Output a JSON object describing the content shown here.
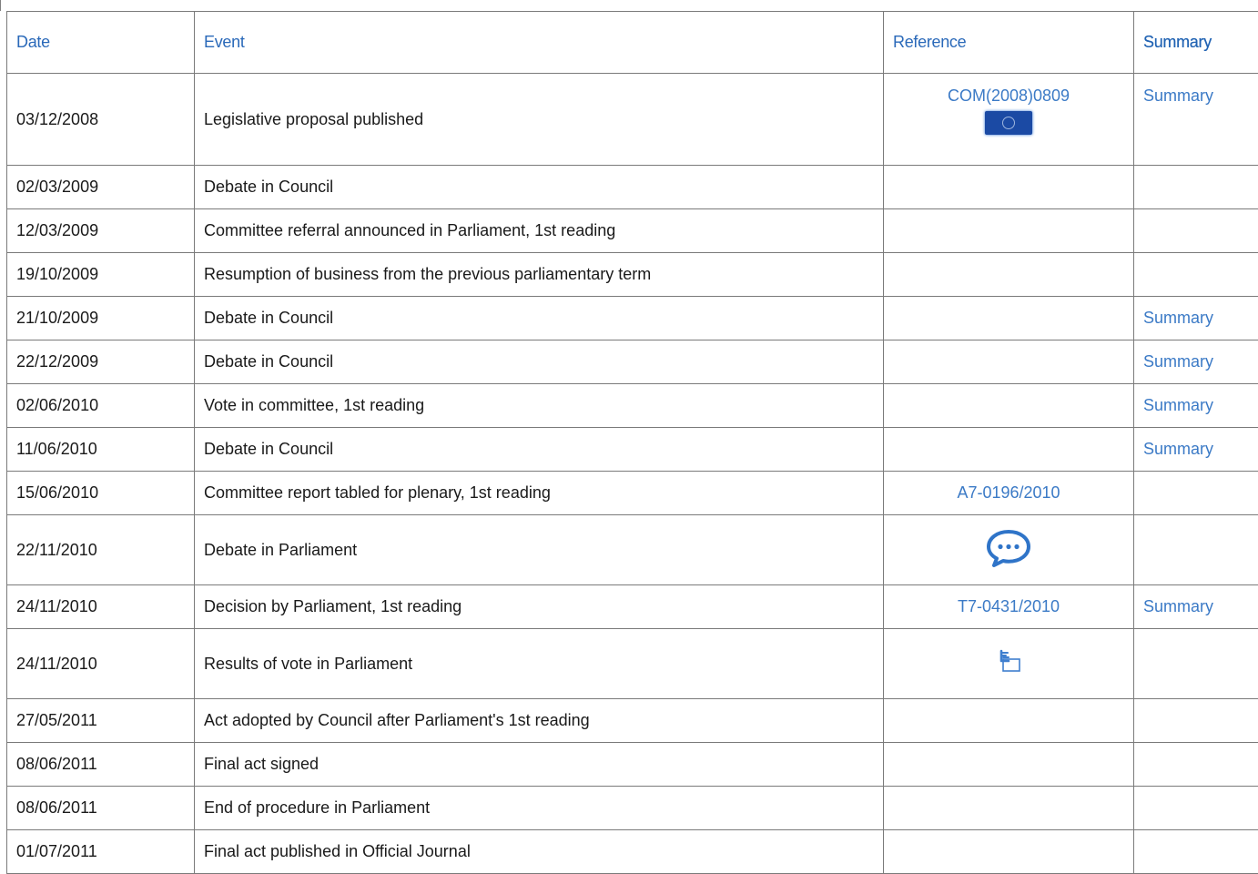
{
  "table": {
    "headers": {
      "date": "Date",
      "event": "Event",
      "reference": "Reference",
      "summary": "Summary"
    },
    "rows": [
      {
        "date": "03/12/2008",
        "event": "Legislative proposal published",
        "reference": "COM(2008)0809",
        "ref_icon": "eu-flag-icon",
        "summary": "Summary"
      },
      {
        "date": "02/03/2009",
        "event": "Debate in Council",
        "reference": "",
        "summary": ""
      },
      {
        "date": "12/03/2009",
        "event": "Committee referral announced in Parliament, 1st reading",
        "reference": "",
        "summary": ""
      },
      {
        "date": "19/10/2009",
        "event": "Resumption of business from the previous parliamentary term",
        "reference": "",
        "summary": ""
      },
      {
        "date": "21/10/2009",
        "event": "Debate in Council",
        "reference": "",
        "summary": "Summary"
      },
      {
        "date": "22/12/2009",
        "event": "Debate in Council",
        "reference": "",
        "summary": "Summary"
      },
      {
        "date": "02/06/2010",
        "event": "Vote in committee, 1st reading",
        "reference": "",
        "summary": "Summary"
      },
      {
        "date": "11/06/2010",
        "event": "Debate in Council",
        "reference": "",
        "summary": "Summary"
      },
      {
        "date": "15/06/2010",
        "event": "Committee report tabled for plenary, 1st reading",
        "reference": "A7-0196/2010",
        "summary": ""
      },
      {
        "date": "22/11/2010",
        "event": "Debate in Parliament",
        "reference": "",
        "ref_icon": "speech-bubble-icon",
        "summary": ""
      },
      {
        "date": "24/11/2010",
        "event": "Decision by Parliament, 1st reading",
        "reference": "T7-0431/2010",
        "summary": "Summary"
      },
      {
        "date": "24/11/2010",
        "event": "Results of vote in Parliament",
        "reference": "",
        "ref_icon": "vote-results-icon",
        "summary": ""
      },
      {
        "date": "27/05/2011",
        "event": "Act adopted by Council after Parliament's 1st reading",
        "reference": "",
        "summary": ""
      },
      {
        "date": "08/06/2011",
        "event": "Final act signed",
        "reference": "",
        "summary": ""
      },
      {
        "date": "08/06/2011",
        "event": "End of procedure in Parliament",
        "reference": "",
        "summary": ""
      },
      {
        "date": "01/07/2011",
        "event": "Final act published in Official Journal",
        "reference": "",
        "summary": ""
      }
    ]
  },
  "colors": {
    "link": "#3b7ac6",
    "header": "#2a69b9",
    "border": "#7a7a7a",
    "text": "#1a1a1a"
  }
}
